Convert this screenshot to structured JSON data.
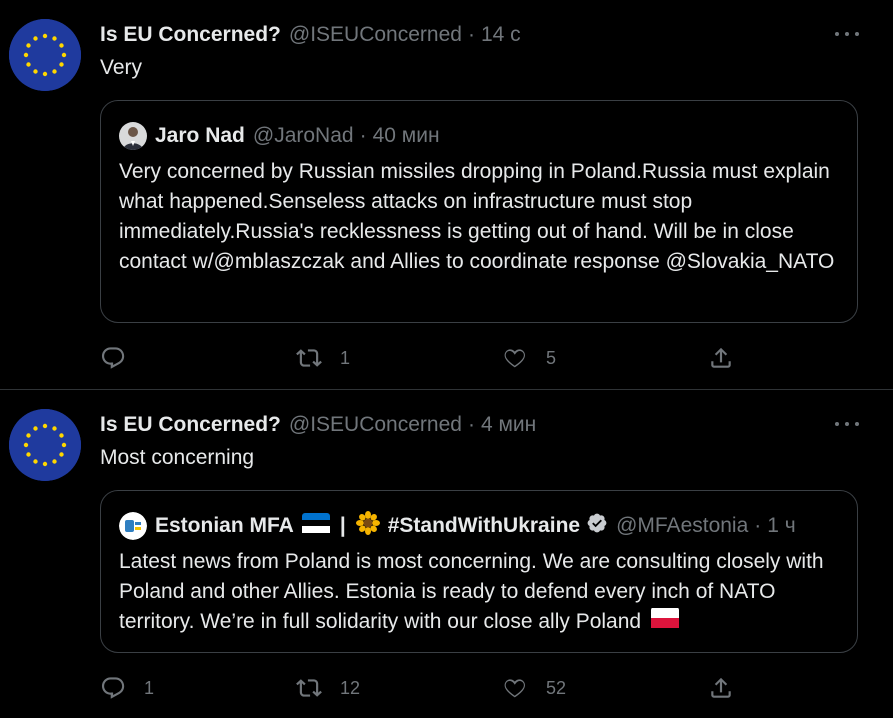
{
  "colors": {
    "background": "#000000",
    "text": "#e7e9ea",
    "muted": "#71767b",
    "border": "#2f3336",
    "verified": "#e7e9ea"
  },
  "tweets": [
    {
      "author_name": "Is EU Concerned?",
      "author_handle": "@ISEUConcerned",
      "separator": "·",
      "time": "14 с",
      "text": "Very",
      "avatar_icon": "eu-flag-icon",
      "quote": {
        "author_name": "Jaro Nad",
        "author_handle": "@JaroNad",
        "separator": "·",
        "time": "40 мин",
        "avatar_icon": "person-avatar-icon",
        "text": "Very concerned by Russian missiles dropping in Poland.Russia must explain what happened.Senseless attacks on infrastructure must stop immediately.Russia's recklessness is getting out of hand. Will be in close contact w/@mblaszczak and Allies to coordinate response @Slovakia_NATO"
      },
      "stats": {
        "reply": "",
        "retweet": "1",
        "like": "5"
      }
    },
    {
      "author_name": "Is EU Concerned?",
      "author_handle": "@ISEUConcerned",
      "separator": "·",
      "time": "4 мин",
      "text": "Most concerning",
      "avatar_icon": "eu-flag-icon",
      "quote": {
        "author_name_part1": "Estonian MFA",
        "author_name_sep": "|",
        "author_name_part2": "#StandWithUkraine",
        "author_handle": "@MFAestonia",
        "separator": "·",
        "time": "1 ч",
        "avatar_icon": "estonia-mfa-logo-icon",
        "text": "Latest news from Poland is most concerning. We are consulting closely with Poland and other Allies. Estonia is ready to defend every inch of NATO territory. We’re in full solidarity with our close ally Poland"
      },
      "stats": {
        "reply": "1",
        "retweet": "12",
        "like": "52"
      }
    }
  ]
}
